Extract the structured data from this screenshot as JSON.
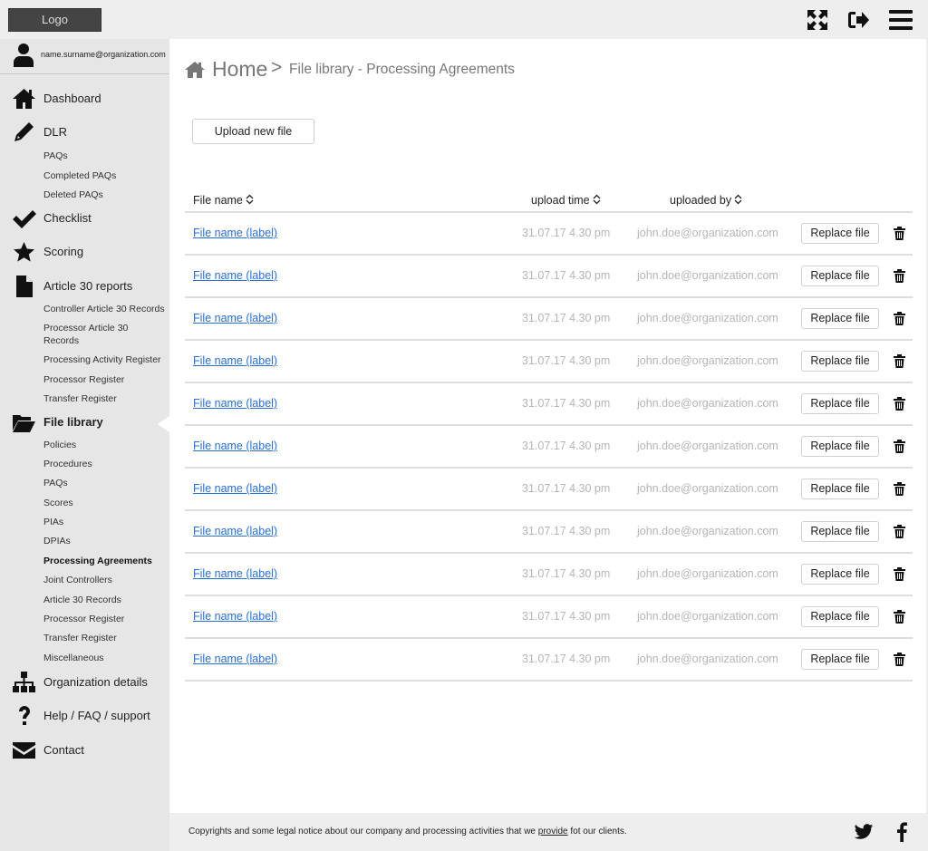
{
  "header": {
    "logo_label": "Logo",
    "icons": [
      "expand-icon",
      "logout-icon",
      "menu-icon"
    ]
  },
  "user": {
    "email": "name.surname@organization.com"
  },
  "sidebar": {
    "sections": [
      {
        "label": "Dashboard",
        "icon": "home-icon",
        "sub": []
      },
      {
        "label": "DLR",
        "icon": "pencil-icon",
        "sub": [
          "PAQs",
          "Completed PAQs",
          "Deleted PAQs"
        ]
      },
      {
        "label": "Checklist",
        "icon": "check-icon",
        "sub": []
      },
      {
        "label": "Scoring",
        "icon": "star-icon",
        "sub": []
      },
      {
        "label": "Article 30 reports",
        "icon": "file-icon",
        "sub": [
          "Controller Article 30 Records",
          "Processor Article 30 Records",
          "Processing Activity Register",
          "Processor Register",
          "Transfer Register"
        ]
      },
      {
        "label": "File library",
        "icon": "folder-open-icon",
        "active": true,
        "sub": [
          "Policies",
          "Procedures",
          "PAQs",
          "Scores",
          "PIAs",
          "DPIAs",
          "Processing Agreements",
          "Joint Controllers",
          "Article 30 Records",
          "Processor Register",
          "Transfer Register",
          "Miscellaneous"
        ]
      },
      {
        "label": "Organization details",
        "icon": "sitemap-icon",
        "sub": []
      },
      {
        "label": "Help / FAQ / support",
        "icon": "question-icon",
        "sub": []
      },
      {
        "label": "Contact",
        "icon": "envelope-icon",
        "sub": []
      }
    ],
    "active_sub": "Processing Agreements"
  },
  "breadcrumb": {
    "home": "Home",
    "separator": ">",
    "current": "File library - Processing Agreements"
  },
  "main": {
    "upload_label": "Upload new file",
    "columns": [
      "File name",
      "upload time",
      "uploaded by"
    ],
    "rows": [
      {
        "file": "File name (label)",
        "time": "31.07.17 4.30 pm",
        "user": "john.doe@organization.com",
        "action": "Replace file"
      },
      {
        "file": "File name (label)",
        "time": "31.07.17 4.30 pm",
        "user": "john.doe@organization.com",
        "action": "Replace file"
      },
      {
        "file": "File name (label)",
        "time": "31.07.17 4.30 pm",
        "user": "john.doe@organization.com",
        "action": "Replace file"
      },
      {
        "file": "File name (label)",
        "time": "31.07.17 4.30 pm",
        "user": "john.doe@organization.com",
        "action": "Replace file"
      },
      {
        "file": "File name (label)",
        "time": "31.07.17 4.30 pm",
        "user": "john.doe@organization.com",
        "action": "Replace file"
      },
      {
        "file": "File name (label)",
        "time": "31.07.17 4.30 pm",
        "user": "john.doe@organization.com",
        "action": "Replace file"
      },
      {
        "file": "File name (label)",
        "time": "31.07.17 4.30 pm",
        "user": "john.doe@organization.com",
        "action": "Replace file"
      },
      {
        "file": "File name (label)",
        "time": "31.07.17 4.30 pm",
        "user": "john.doe@organization.com",
        "action": "Replace file"
      },
      {
        "file": "File name (label)",
        "time": "31.07.17 4.30 pm",
        "user": "john.doe@organization.com",
        "action": "Replace file"
      },
      {
        "file": "File name (label)",
        "time": "31.07.17 4.30 pm",
        "user": "john.doe@organization.com",
        "action": "Replace file"
      },
      {
        "file": "File name (label)",
        "time": "31.07.17 4.30 pm",
        "user": "john.doe@organization.com",
        "action": "Replace file"
      }
    ]
  },
  "footer": {
    "text_before": "Copyrights and some legal notice about our company and processing activities that we ",
    "link": "provide",
    "text_after": " fot our clients.",
    "social": [
      "twitter-icon",
      "facebook-icon"
    ]
  },
  "colors": {
    "link": "#2a6fd6",
    "muted": "#b5b5b5",
    "sidebar_bg": "#e6e6e6",
    "bar_bg": "#eeeeee"
  }
}
